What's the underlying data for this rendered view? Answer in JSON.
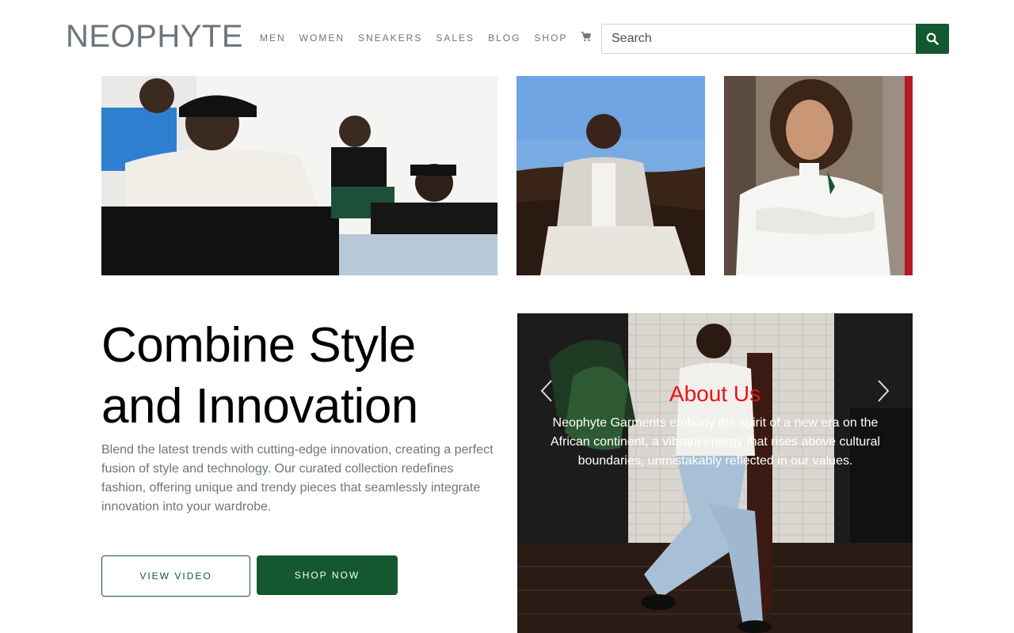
{
  "header": {
    "logo": "NEOPHYTE",
    "nav": [
      "MEN",
      "WOMEN",
      "SNEAKERS",
      "SALES",
      "BLOG",
      "SHOP"
    ],
    "search_placeholder": "Search"
  },
  "hero": {
    "title_line1": "Combine Style",
    "title_line2": "and Innovation",
    "description": "Blend the latest trends with cutting-edge innovation, creating a perfect fusion of style and technology. Our curated collection redefines fashion, offering unique and trendy pieces that seamlessly integrate innovation into your wardrobe.",
    "view_video_label": "VIEW VIDEO",
    "shop_now_label": "SHOP NOW"
  },
  "carousel": {
    "title": "About Us",
    "text": "Neophyte Garments embody the spirit of a new era on the African continent, a vibrant energy that rises above cultural boundaries, unmistakably reflected in our values."
  },
  "colors": {
    "brand_green": "#13582f",
    "carousel_title_red": "#e8141a",
    "muted_text": "#6c757d"
  },
  "icons": {
    "cart": "cart-icon",
    "search": "search-icon",
    "prev": "chevron-left-icon",
    "next": "chevron-right-icon"
  }
}
